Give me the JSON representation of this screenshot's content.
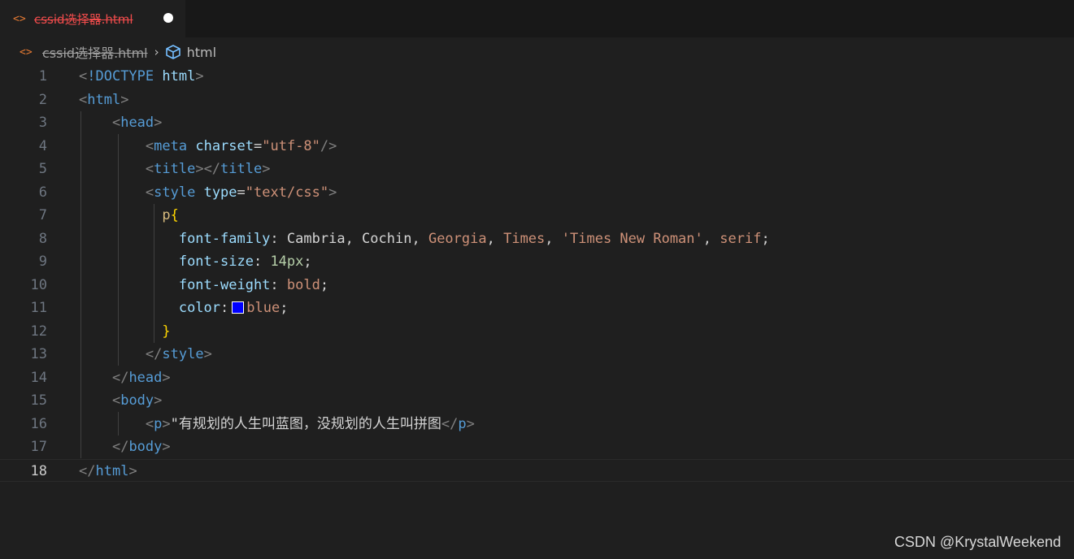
{
  "tab": {
    "icon": "code-brackets-icon",
    "label": "cssid选择器.html",
    "modified": true
  },
  "breadcrumb": {
    "file": "cssid选择器.html",
    "symbol_icon": "cube-icon",
    "symbol": "html"
  },
  "editor": {
    "active_line": 18,
    "line_numbers": [
      "1",
      "2",
      "3",
      "4",
      "5",
      "6",
      "7",
      "8",
      "9",
      "10",
      "11",
      "12",
      "13",
      "14",
      "15",
      "16",
      "17",
      "18"
    ],
    "tokens": {
      "doctype": "!DOCTYPE",
      "html": "html",
      "head": "head",
      "meta": "meta",
      "charset": "charset",
      "charset_val": "\"utf-8\"",
      "title": "title",
      "style": "style",
      "type": "type",
      "type_val": "\"text/css\"",
      "selector": "p",
      "font_family_prop": "font-family",
      "ff_cambria": "Cambria",
      "ff_cochin": "Cochin",
      "ff_georgia": "Georgia",
      "ff_times": "Times",
      "ff_tnr": "'Times New Roman'",
      "ff_serif": "serif",
      "font_size_prop": "font-size",
      "font_size_val": "14px",
      "font_weight_prop": "font-weight",
      "font_weight_val": "bold",
      "color_prop": "color",
      "color_val": "blue",
      "body": "body",
      "p": "p",
      "p_text": "\"有规划的人生叫蓝图，没规划的人生叫拼图"
    }
  },
  "colors": {
    "swatch": "#0000ff",
    "modified_dot": "#ffffff",
    "tab_label": "#f14c4c"
  },
  "watermark": "CSDN @KrystalWeekend"
}
